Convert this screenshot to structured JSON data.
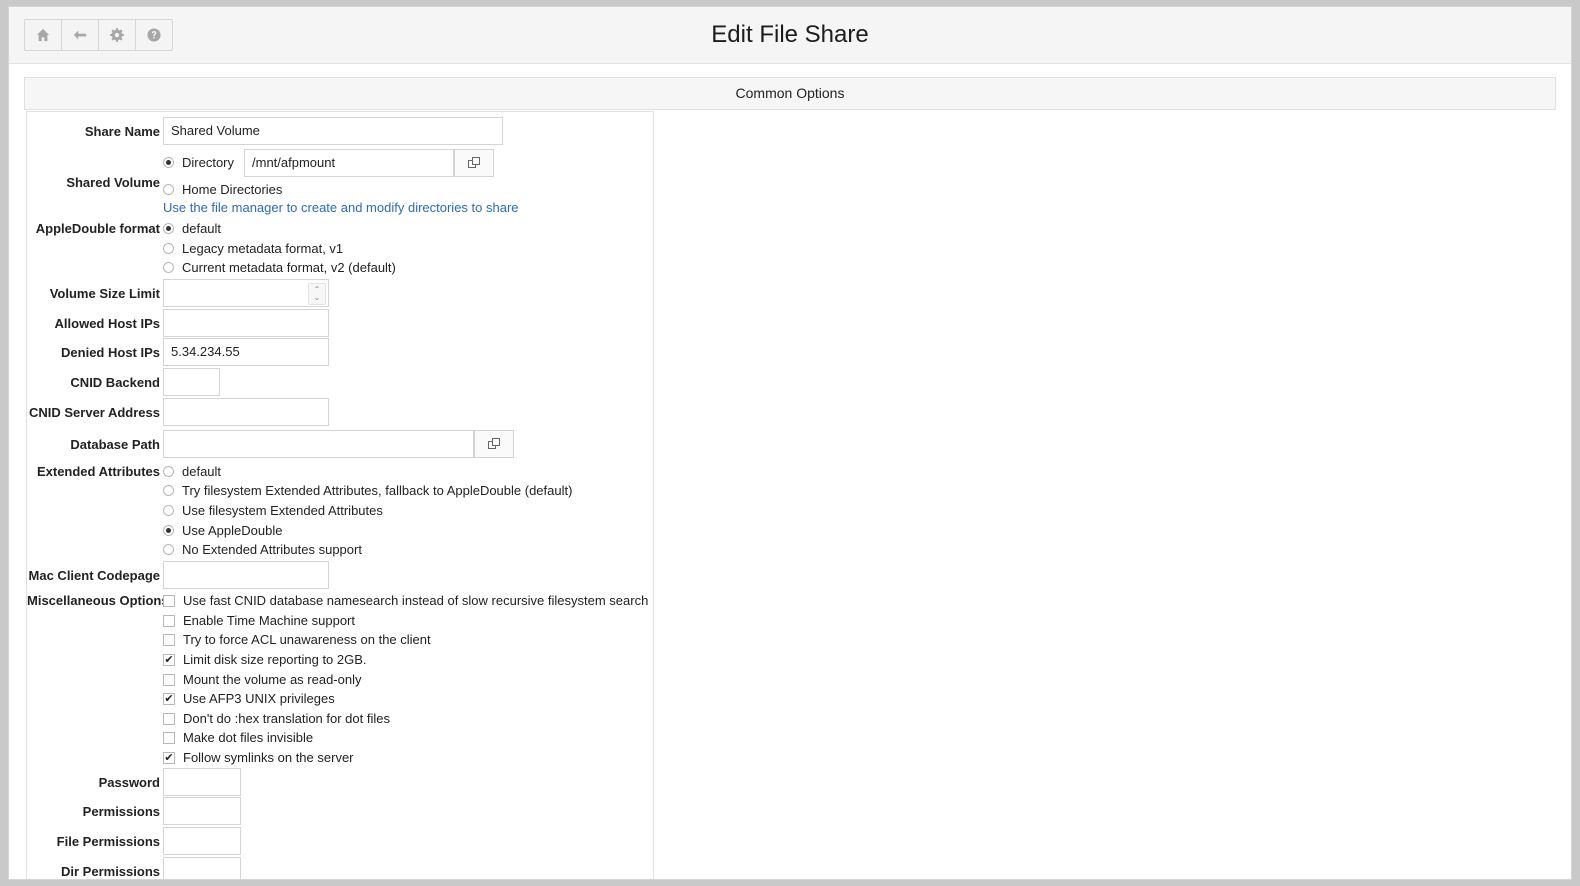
{
  "toolbar": {
    "home_icon": "home-icon",
    "back_icon": "return-arrow-icon",
    "settings_icon": "gear-icon",
    "help_icon": "help-icon"
  },
  "header": {
    "title": "Edit File Share"
  },
  "section": {
    "title": "Common Options"
  },
  "form": {
    "share_name": {
      "label": "Share Name",
      "value": "Shared Volume"
    },
    "shared_volume": {
      "label": "Shared Volume",
      "options": [
        "Directory",
        "Home Directories"
      ],
      "selected": "Directory",
      "directory_value": "/mnt/afpmount",
      "help_link": "Use the file manager to create and modify directories to share"
    },
    "appledouble": {
      "label": "AppleDouble format",
      "options": [
        "default",
        "Legacy metadata format, v1",
        "Current metadata format, v2 (default)"
      ],
      "selected": "default"
    },
    "volume_size_limit": {
      "label": "Volume Size Limit",
      "value": ""
    },
    "allowed_host_ips": {
      "label": "Allowed Host IPs",
      "value": ""
    },
    "denied_host_ips": {
      "label": "Denied Host IPs",
      "value": "5.34.234.55"
    },
    "cnid_backend": {
      "label": "CNID Backend",
      "value": ""
    },
    "cnid_server_address": {
      "label": "CNID Server Address",
      "value": ""
    },
    "database_path": {
      "label": "Database Path",
      "value": ""
    },
    "extended_attributes": {
      "label": "Extended Attributes",
      "options": [
        "default",
        "Try filesystem Extended Attributes, fallback to AppleDouble (default)",
        "Use filesystem Extended Attributes",
        "Use AppleDouble",
        "No Extended Attributes support"
      ],
      "selected": "Use AppleDouble"
    },
    "mac_client_codepage": {
      "label": "Mac Client Codepage",
      "value": ""
    },
    "misc_options": {
      "label": "Miscellaneous Options",
      "items": [
        {
          "label": "Use fast CNID database namesearch instead of slow recursive filesystem search",
          "checked": false
        },
        {
          "label": "Enable Time Machine support",
          "checked": false
        },
        {
          "label": "Try to force ACL unawareness on the client",
          "checked": false
        },
        {
          "label": "Limit disk size reporting to 2GB.",
          "checked": true
        },
        {
          "label": "Mount the volume as read-only",
          "checked": false
        },
        {
          "label": "Use AFP3 UNIX privileges",
          "checked": true
        },
        {
          "label": "Don't do :hex translation for dot files",
          "checked": false
        },
        {
          "label": "Make dot files invisible",
          "checked": false
        },
        {
          "label": "Follow symlinks on the server",
          "checked": true
        }
      ]
    },
    "password": {
      "label": "Password",
      "value": ""
    },
    "permissions": {
      "label": "Permissions",
      "value": ""
    },
    "file_permissions": {
      "label": "File Permissions",
      "value": ""
    },
    "dir_permissions": {
      "label": "Dir Permissions",
      "value": ""
    }
  }
}
